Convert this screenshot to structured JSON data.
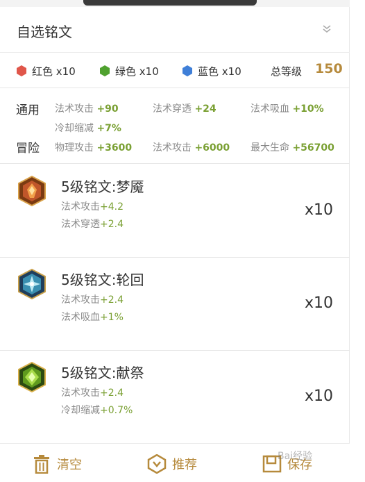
{
  "header": {
    "title": "自选铭文"
  },
  "colors": {
    "red": {
      "label": "红色 x10",
      "hex": "#e0564a"
    },
    "green": {
      "label": "绿色 x10",
      "hex": "#4fa12f"
    },
    "blue": {
      "label": "蓝色 x10",
      "hex": "#3f7fd8"
    },
    "total_label": "总等级",
    "total_value": "150"
  },
  "stats": {
    "general": {
      "label": "通用",
      "items": [
        {
          "name": "法术攻击",
          "value": "+90"
        },
        {
          "name": "法术穿透",
          "value": "+24"
        },
        {
          "name": "法术吸血",
          "value": "+10%"
        },
        {
          "name": "冷却缩减",
          "value": "+7%"
        }
      ]
    },
    "adventure": {
      "label": "冒险",
      "items": [
        {
          "name": "物理攻击",
          "value": "+3600"
        },
        {
          "name": "法术攻击",
          "value": "+6000"
        },
        {
          "name": "最大生命",
          "value": "+56700"
        }
      ]
    }
  },
  "runes": [
    {
      "name": "5级铭文:梦魇",
      "color": "red",
      "icon": "red-rune-icon",
      "attrs": [
        {
          "name": "法术攻击",
          "value": "+4.2"
        },
        {
          "name": "法术穿透",
          "value": "+2.4"
        }
      ],
      "count": "x10"
    },
    {
      "name": "5级铭文:轮回",
      "color": "blue",
      "icon": "blue-rune-icon",
      "attrs": [
        {
          "name": "法术攻击",
          "value": "+2.4"
        },
        {
          "name": "法术吸血",
          "value": "+1%"
        }
      ],
      "count": "x10"
    },
    {
      "name": "5级铭文:献祭",
      "color": "green",
      "icon": "green-rune-icon",
      "attrs": [
        {
          "name": "法术攻击",
          "value": "+2.4"
        },
        {
          "name": "冷却缩减",
          "value": "+0.7%"
        }
      ],
      "count": "x10"
    }
  ],
  "footer": {
    "clear_label": "清空",
    "recommend_label": "推荐",
    "save_label": "保存",
    "accent": "#b68a3c"
  },
  "watermark": "Bai经验"
}
